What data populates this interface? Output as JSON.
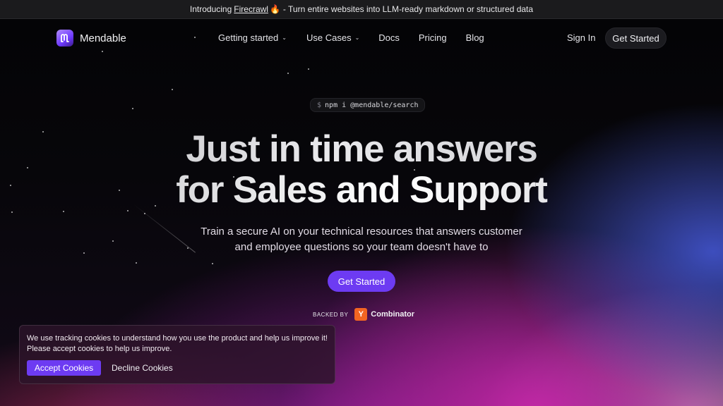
{
  "announcement": {
    "prefix": "Introducing",
    "link_text": "Firecrawl",
    "emoji": "🔥",
    "suffix": "- Turn entire websites into LLM-ready markdown or structured data"
  },
  "nav": {
    "brand": "Mendable",
    "items": [
      {
        "label": "Getting started",
        "has_dropdown": true
      },
      {
        "label": "Use Cases",
        "has_dropdown": true
      },
      {
        "label": "Docs",
        "has_dropdown": false
      },
      {
        "label": "Pricing",
        "has_dropdown": false
      },
      {
        "label": "Blog",
        "has_dropdown": false
      }
    ],
    "sign_in": "Sign In",
    "cta": "Get Started"
  },
  "hero": {
    "install_prompt": "$",
    "install_command": "npm i @mendable/search",
    "headline_line1": "Just in time answers",
    "headline_line2": "for Sales and Support",
    "subtitle_line1": "Train a secure AI on your technical resources that answers customer",
    "subtitle_line2": "and employee questions so your team doesn't have to",
    "cta": "Get Started",
    "backed_by_label": "BACKED BY",
    "backer_logo_letter": "Y",
    "backer_name": "Combinator"
  },
  "cookie_banner": {
    "line1": "We use tracking cookies to understand how you use the product and help us improve it!",
    "line2": "Please accept cookies to help us improve.",
    "accept": "Accept Cookies",
    "decline": "Decline Cookies"
  },
  "colors": {
    "accent": "#6d3bf2",
    "yc_orange": "#f26522",
    "background": "#050507"
  },
  "icons": {
    "logo": "mendable-logo-icon",
    "dropdown": "chevron-down-icon",
    "fire": "fire-icon"
  }
}
